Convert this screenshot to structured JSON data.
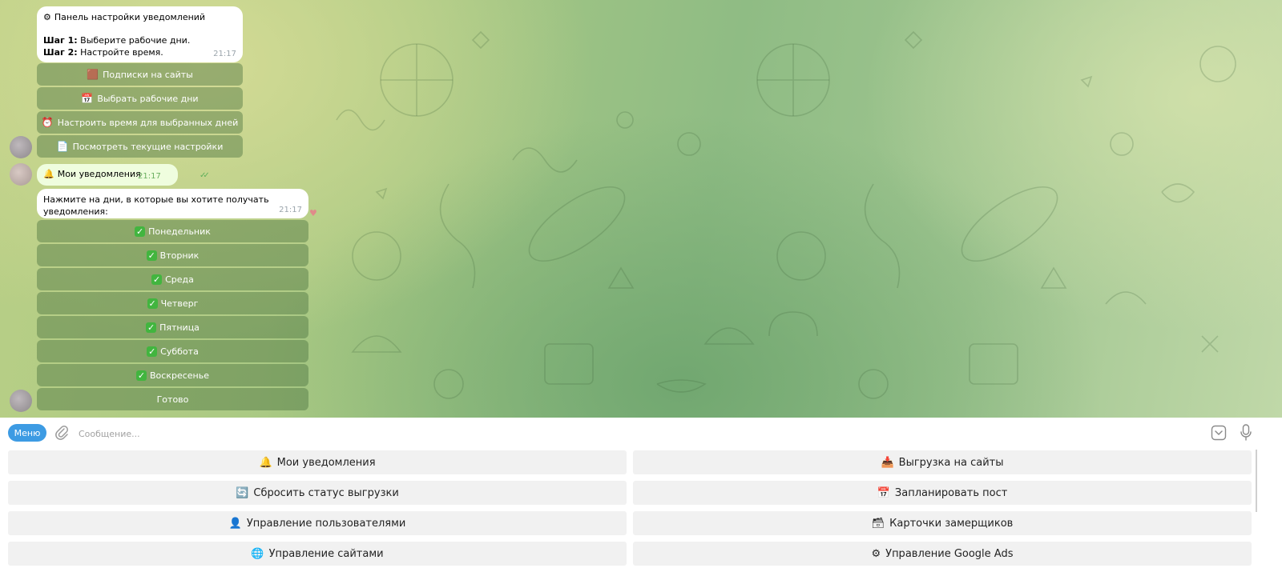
{
  "chat": {
    "settings_message": {
      "title_icon": "gear-icon",
      "title": "Панель настройки уведомлений",
      "step1_label": "Шаг 1:",
      "step1_text": " Выберите рабочие дни.",
      "step2_label": "Шаг 2:",
      "step2_text": " Настройте время.",
      "time": "21:17"
    },
    "settings_buttons": [
      {
        "icon": "books-icon",
        "emoji": "🟫",
        "label": "Подписки на сайты"
      },
      {
        "icon": "calendar-icon",
        "emoji": "📅",
        "label": "Выбрать рабочие дни"
      },
      {
        "icon": "alarm-clock-icon",
        "emoji": "⏰",
        "label": "Настроить время для выбранных дней"
      },
      {
        "icon": "document-icon",
        "emoji": "📄",
        "label": "Посмотреть текущие настройки"
      }
    ],
    "outgoing_message": {
      "icon": "bell-icon",
      "emoji": "🔔",
      "text": "Мои уведомления",
      "time": "21:17",
      "status": "read"
    },
    "days_message": {
      "text": "Нажмите на дни, в которые вы хотите получать уведомления:",
      "time": "21:17"
    },
    "day_buttons": [
      {
        "checked": true,
        "label": "Понедельник"
      },
      {
        "checked": true,
        "label": "Вторник"
      },
      {
        "checked": true,
        "label": "Среда"
      },
      {
        "checked": true,
        "label": "Четверг"
      },
      {
        "checked": true,
        "label": "Пятница"
      },
      {
        "checked": true,
        "label": "Суббота"
      },
      {
        "checked": true,
        "label": "Воскресенье"
      }
    ],
    "done_button": "Готово",
    "check_glyph": "✓"
  },
  "composer": {
    "menu_label": "Меню",
    "placeholder": "Сообщение..."
  },
  "reply_keyboard": [
    {
      "icon": "bell-icon",
      "emoji": "🔔",
      "label": "Мои уведомления"
    },
    {
      "icon": "inbox-tray-icon",
      "emoji": "📥",
      "label": "Выгрузка на сайты"
    },
    {
      "icon": "refresh-icon",
      "emoji": "🔄",
      "label": "Сбросить статус выгрузки"
    },
    {
      "icon": "calendar-icon",
      "emoji": "📅",
      "label": "Запланировать пост"
    },
    {
      "icon": "person-icon",
      "emoji": "👤",
      "label": "Управление пользователями"
    },
    {
      "icon": "card-box-icon",
      "emoji": "🗃",
      "label": "Карточки замерщиков"
    },
    {
      "icon": "globe-icon",
      "emoji": "🌐",
      "label": "Управление сайтами"
    },
    {
      "icon": "gear-icon",
      "emoji": "⚙",
      "label": "Управление Google Ads"
    }
  ],
  "colors": {
    "accent": "#3d9be3",
    "check_green": "#42b53f",
    "outgoing_bubble": "#effdde"
  }
}
